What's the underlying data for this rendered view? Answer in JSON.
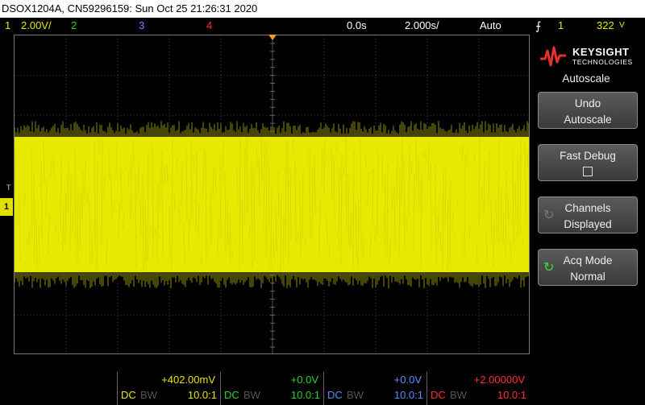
{
  "title_bar": {
    "text": "DSOX1204A, CN59296159: Sun Oct 25 21:26:31 2020"
  },
  "status": {
    "ch1_num": "1",
    "ch1_scale": "2.00V/",
    "ch2_num": "2",
    "ch3_num": "3",
    "ch4_num": "4",
    "time_delay": "0.0s",
    "time_scale": "2.000s/",
    "trigger_mode": "Auto",
    "trigger_icon": "⨍",
    "trig_channel": "1",
    "trig_level": "322",
    "trig_level_icon": "V"
  },
  "colors": {
    "ch1": "#e8e800",
    "ch2": "#30d030",
    "ch3": "#5d8cff",
    "ch4": "#ff3030",
    "trigger": "#ff9a1f"
  },
  "markers": {
    "ch1_ground": "1",
    "trig_t": "T"
  },
  "panel": {
    "logo_brand": "KEYSIGHT",
    "logo_sub": "TECHNOLOGIES",
    "menu_title": "Autoscale",
    "softkeys": [
      {
        "line1": "Undo",
        "line2": "Autoscale"
      },
      {
        "line1": "Fast Debug",
        "line2": ""
      },
      {
        "line1": "Channels",
        "line2": "Displayed"
      },
      {
        "line1": "Acq Mode",
        "line2": "Normal"
      }
    ]
  },
  "channels": [
    {
      "offset": "+402.00mV",
      "coupling": "DC",
      "bw": "BW",
      "probe": "10.0:1"
    },
    {
      "offset": "+0.0V",
      "coupling": "DC",
      "bw": "BW",
      "probe": "10.0:1"
    },
    {
      "offset": "+0.0V",
      "coupling": "DC",
      "bw": "BW",
      "probe": "10.0:1"
    },
    {
      "offset": "+2.00000V",
      "coupling": "DC",
      "bw": "BW",
      "probe": "10.0:1"
    }
  ]
}
